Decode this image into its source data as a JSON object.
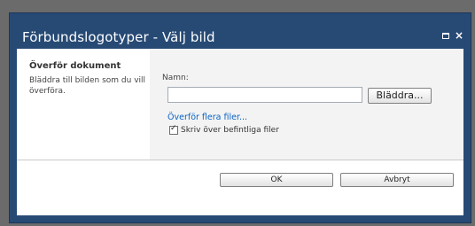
{
  "dialog": {
    "title": "Förbundslogotyper - Välj bild",
    "controls": {
      "maximize_icon": "maximize-icon",
      "close_icon": "close-icon",
      "close_symbol": "×"
    }
  },
  "left_panel": {
    "heading": "Överför dokument",
    "description": "Bläddra till bilden som du vill överföra."
  },
  "form": {
    "name_label": "Namn:",
    "name_value": "",
    "browse_label": "Bläddra...",
    "upload_multiple_link": "Överför flera filer...",
    "overwrite_checked": true,
    "overwrite_label": "Skriv över befintliga filer"
  },
  "buttons": {
    "ok_label": "OK",
    "cancel_label": "Avbryt"
  },
  "colors": {
    "titlebar": "#274a75",
    "link": "#0a63c4",
    "panel": "#f3f3f3"
  }
}
